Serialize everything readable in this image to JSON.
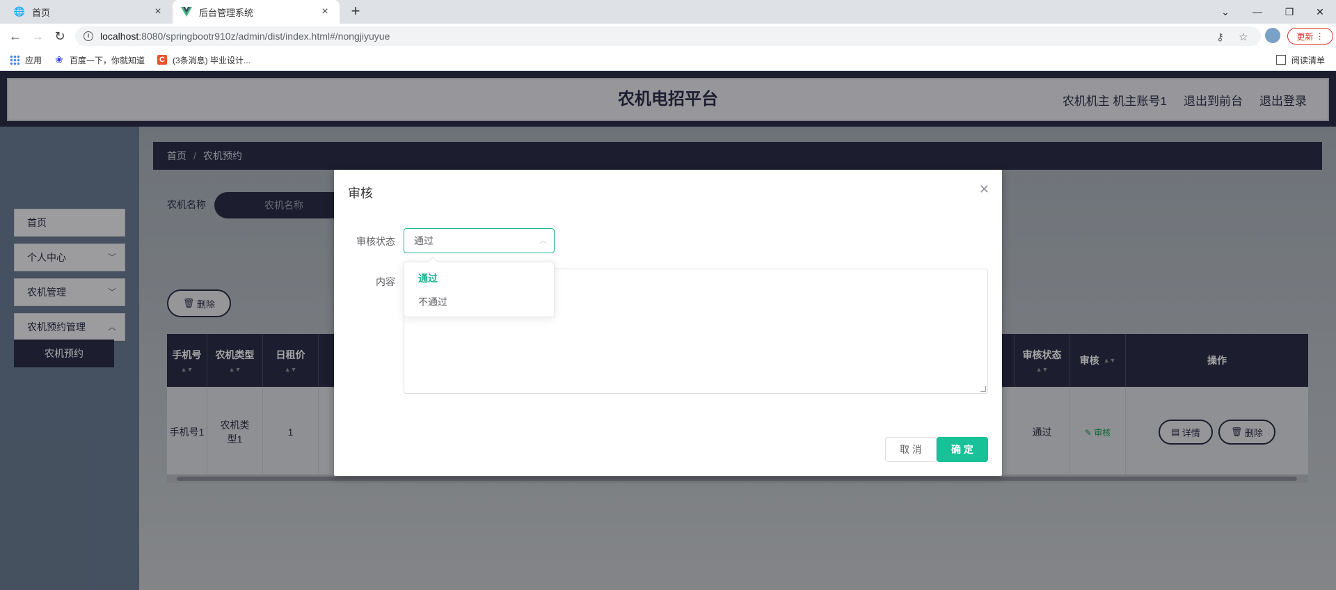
{
  "browser": {
    "tabs": [
      {
        "title": "首页",
        "icon": "globe-icon"
      },
      {
        "title": "后台管理系统",
        "icon": "vue-logo-icon"
      }
    ],
    "url_host": "localhost",
    "url_rest": ":8080/springbootr910z/admin/dist/index.html#/nongjiyuyue",
    "update_label": "更新",
    "bookmarks": [
      "应用",
      "百度一下，你就知道",
      "(3条消息) 毕业设计...",
      "阅读清单"
    ]
  },
  "header": {
    "title": "农机电招平台",
    "user": "农机机主 机主账号1",
    "to_front": "退出到前台",
    "logout": "退出登录"
  },
  "sidebar": {
    "items": [
      {
        "label": "首页"
      },
      {
        "label": "个人中心"
      },
      {
        "label": "农机管理"
      },
      {
        "label": "农机预约管理"
      }
    ],
    "sub_item": "农机预约"
  },
  "breadcrumb": {
    "home": "首页",
    "current": "农机预约"
  },
  "filter": {
    "label": "农机名称",
    "placeholder": "农机名称"
  },
  "toolbar": {
    "delete_label": "删除"
  },
  "table": {
    "columns": [
      "手机号",
      "农机类型",
      "日租价",
      "审核状态",
      "审核",
      "操作"
    ],
    "row": {
      "phone": "手机号1",
      "type": "农机类型1",
      "price": "1",
      "status": "通过",
      "audit": "审核",
      "detail_btn": "详情",
      "delete_btn": "删除"
    }
  },
  "dialog": {
    "title": "审核",
    "status_label": "审核状态",
    "status_value": "通过",
    "content_label": "内容",
    "options": [
      "通过",
      "不通过"
    ],
    "selected_option": "通过",
    "cancel_label": "取 消",
    "ok_label": "确 定"
  },
  "colors": {
    "primary_dark": "#2b2e4a",
    "accent_green": "#18c198"
  }
}
